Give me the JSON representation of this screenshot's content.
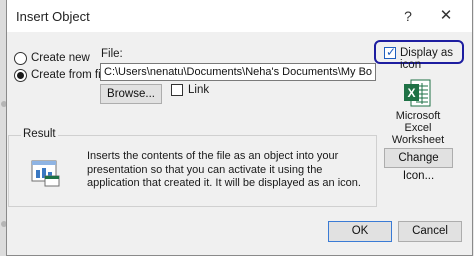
{
  "window": {
    "title": "Insert Object",
    "help_glyph": "?",
    "close_glyph": "✕"
  },
  "options": {
    "create_new": "Create new",
    "create_from_file": "Create from file",
    "selected": "create_from_file"
  },
  "file": {
    "label": "File:",
    "value": "C:\\Users\\nenatu\\Documents\\Neha's Documents\\My Books.xlsx",
    "browse_label": "Browse...",
    "link_label": "Link",
    "link_checked": false
  },
  "display": {
    "label": "Display as icon",
    "checked": true,
    "icon_name": "excel-icon",
    "icon_caption": [
      "Microsoft",
      "Excel",
      "Worksheet"
    ],
    "change_icon_label": "Change Icon..."
  },
  "result": {
    "label": "Result",
    "text": "Inserts the contents of the file as an object into your presentation so that you can activate it using the application that created it. It will be displayed as an icon."
  },
  "buttons": {
    "ok": "OK",
    "cancel": "Cancel"
  },
  "colors": {
    "highlight": "#1d1da0",
    "excel_green": "#1e7145",
    "accent": "#1f5fbf"
  }
}
